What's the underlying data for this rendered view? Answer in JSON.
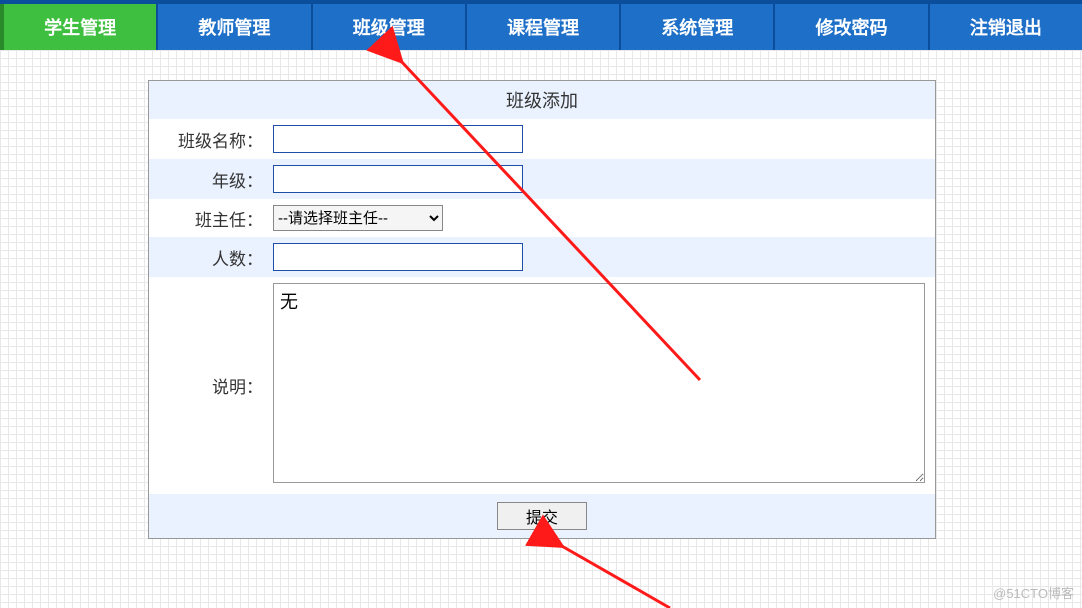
{
  "nav": {
    "items": [
      {
        "label": "学生管理",
        "active": true
      },
      {
        "label": "教师管理",
        "active": false
      },
      {
        "label": "班级管理",
        "active": false
      },
      {
        "label": "课程管理",
        "active": false
      },
      {
        "label": "系统管理",
        "active": false
      },
      {
        "label": "修改密码",
        "active": false
      },
      {
        "label": "注销退出",
        "active": false
      }
    ]
  },
  "form": {
    "title": "班级添加",
    "labels": {
      "class_name": "班级名称：",
      "grade": "年级：",
      "head_teacher": "班主任：",
      "count": "人数：",
      "description": "说明："
    },
    "values": {
      "class_name": "",
      "grade": "",
      "count": "",
      "description": "无"
    },
    "teacher_select": {
      "placeholder": "--请选择班主任--"
    },
    "submit_label": "提交"
  },
  "watermark": "@51CTO博客"
}
